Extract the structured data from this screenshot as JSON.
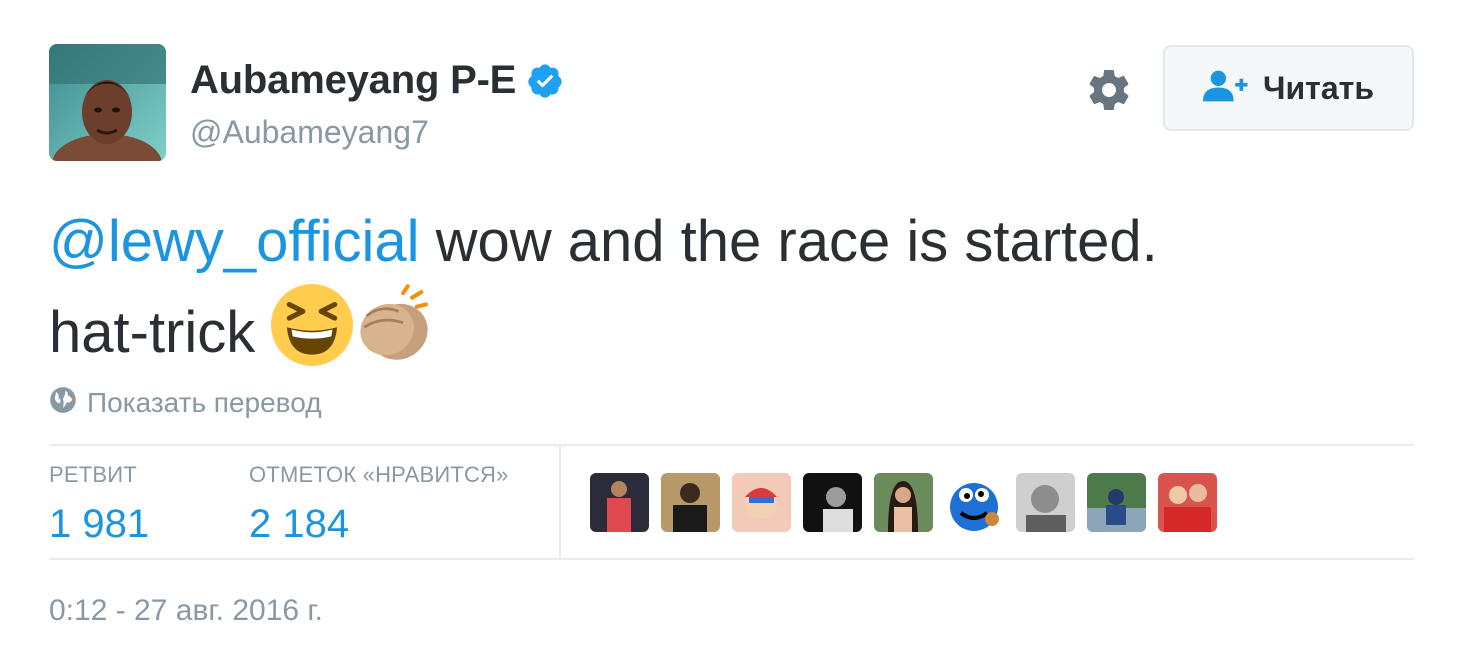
{
  "user": {
    "name": "Aubameyang P-E",
    "handle": "@Aubameyang7",
    "verified": true,
    "avatar_icon": "profile-photo"
  },
  "actions": {
    "settings_icon": "gear-icon",
    "follow_label": "Читать",
    "follow_icon": "add-user-icon"
  },
  "tweet": {
    "mention": "@lewy_official",
    "text_line1": " wow and the race is started.",
    "text_line2": "hat-trick ",
    "emojis": [
      "grinning-squinting-face",
      "clapping-hands-medium-skin"
    ]
  },
  "translate": {
    "label": "Показать перевод",
    "icon": "globe-icon"
  },
  "stats": {
    "retweets_label": "РЕТВИТ",
    "retweets_value": "1 981",
    "likes_label": "ОТМЕТОК «НРАВИТСЯ»",
    "likes_value": "2 184"
  },
  "likers": [
    {
      "name": "liker-1"
    },
    {
      "name": "liker-2"
    },
    {
      "name": "liker-3"
    },
    {
      "name": "liker-4"
    },
    {
      "name": "liker-5"
    },
    {
      "name": "liker-6"
    },
    {
      "name": "liker-7"
    },
    {
      "name": "liker-8"
    },
    {
      "name": "liker-9"
    }
  ],
  "timestamp": "0:12 - 27 авг. 2016 г.",
  "colors": {
    "accent": "#1b95e0",
    "muted": "#8899a6",
    "text": "#292f33",
    "verified": "#1da1f2"
  }
}
